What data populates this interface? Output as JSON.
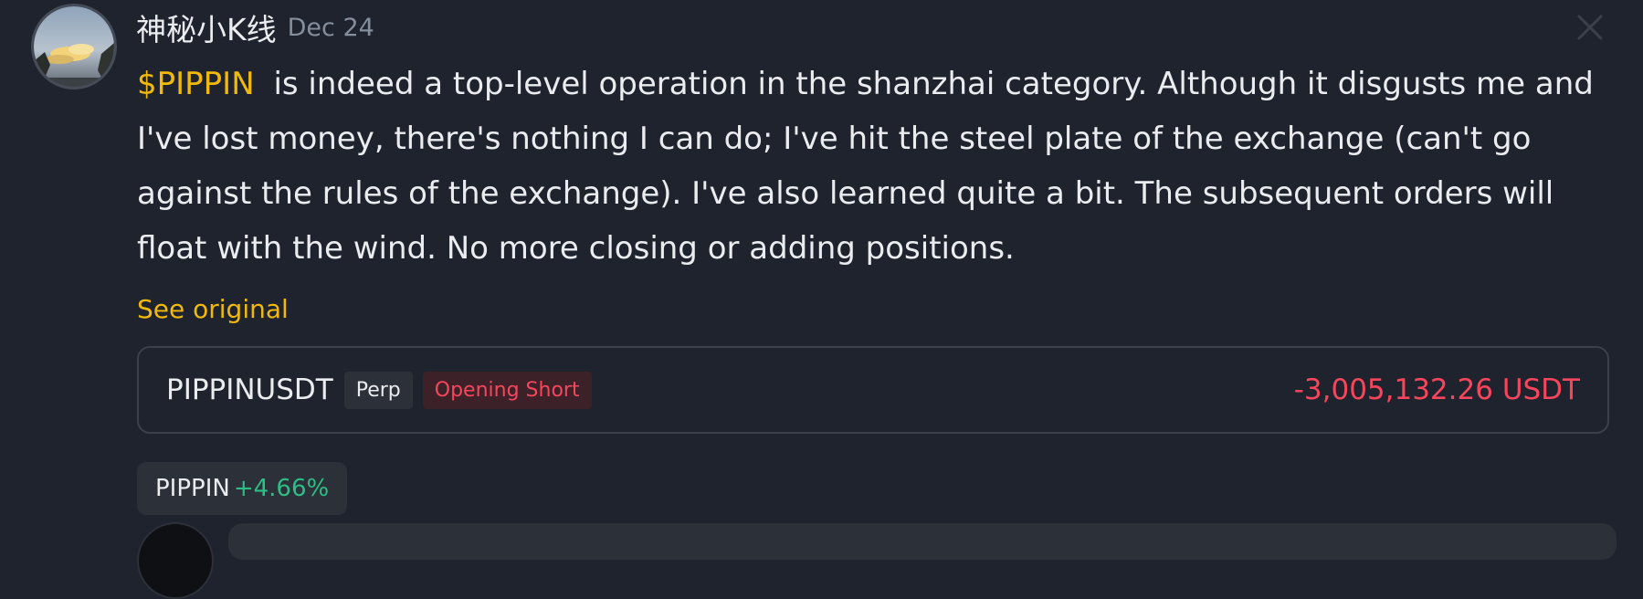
{
  "post": {
    "author": "神秘小K线",
    "date": "Dec 24",
    "ticker": "$PIPPIN",
    "body": "is indeed a top-level operation in the shanzhai category. Although it disgusts me and I've lost money, there's nothing I can do; I've hit the steel plate of the exchange (can't go against the rules of the exchange). I've also learned quite a bit. The subsequent orders will float with the wind. No more closing or adding positions.",
    "see_original": "See original"
  },
  "position": {
    "symbol": "PIPPINUSDT",
    "type_tag": "Perp",
    "side_tag": "Opening Short",
    "pnl": "-3,005,132.26 USDT"
  },
  "coin": {
    "name": "PIPPIN",
    "change": "+4.66%"
  },
  "colors": {
    "background": "#1f232d",
    "accent": "#f0b90b",
    "negative": "#f6465d",
    "positive": "#2ebd85"
  },
  "icons": [
    "avatar",
    "close-icon"
  ]
}
